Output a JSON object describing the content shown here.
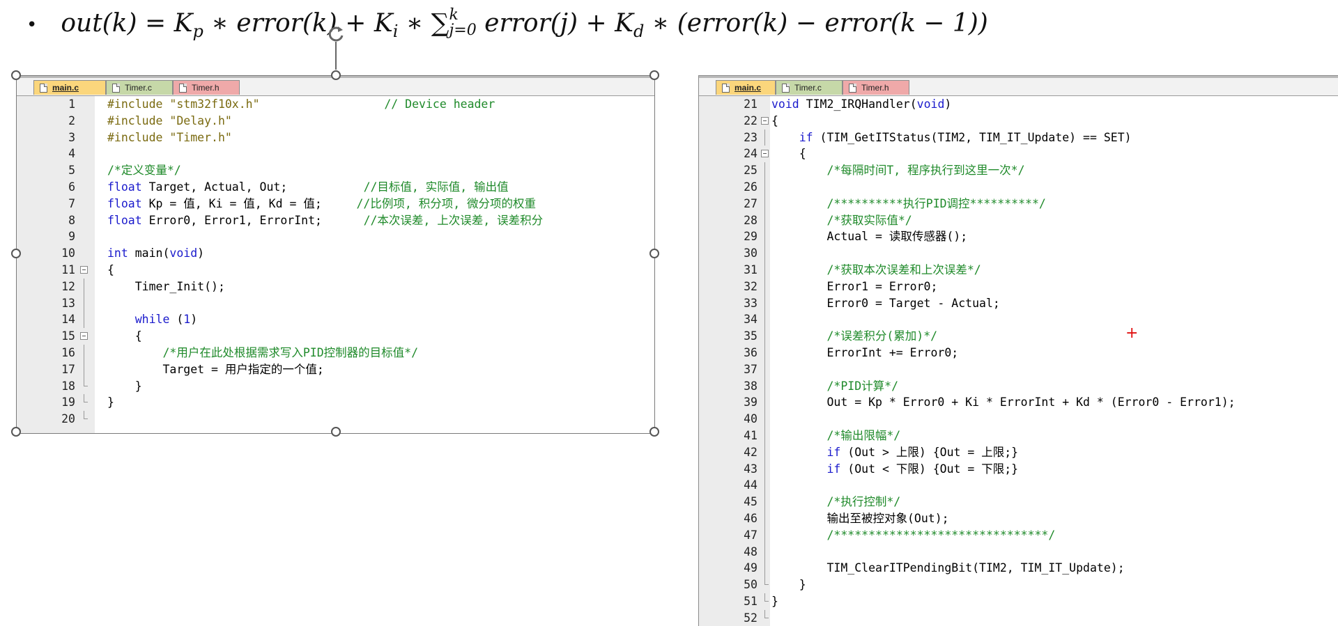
{
  "formula": {
    "bullet": "•",
    "lhs": "out(k) = K",
    "kp_sub": "p",
    "t1": " ∗ error(k) + K",
    "ki_sub": "i",
    "t2": " ∗ ",
    "sum": "∑",
    "sum_sup": "k",
    "sum_sub": "j=0",
    "t3": " error(j) + K",
    "kd_sub": "d",
    "t4": " ∗ (error(k) − error(k − 1))"
  },
  "tabs": [
    "main.c",
    "Timer.c",
    "Timer.h"
  ],
  "left_code": [
    {
      "n": "1",
      "fold": "",
      "segs": [
        [
          "pp",
          "#include "
        ],
        [
          "str",
          "\"stm32f10x.h\""
        ],
        [
          "",
          "                  "
        ],
        [
          "cm",
          "// Device header"
        ]
      ]
    },
    {
      "n": "2",
      "fold": "",
      "segs": [
        [
          "pp",
          "#include "
        ],
        [
          "str",
          "\"Delay.h\""
        ]
      ]
    },
    {
      "n": "3",
      "fold": "",
      "segs": [
        [
          "pp",
          "#include "
        ],
        [
          "str",
          "\"Timer.h\""
        ]
      ]
    },
    {
      "n": "4",
      "fold": "",
      "segs": []
    },
    {
      "n": "5",
      "fold": "",
      "segs": [
        [
          "cm",
          "/*定义变量*/"
        ]
      ]
    },
    {
      "n": "6",
      "fold": "",
      "segs": [
        [
          "kw",
          "float"
        ],
        [
          "",
          " Target, Actual, Out;           "
        ],
        [
          "cm",
          "//目标值, 实际值, 输出值"
        ]
      ]
    },
    {
      "n": "7",
      "fold": "",
      "segs": [
        [
          "kw",
          "float"
        ],
        [
          "",
          " Kp = 值, Ki = 值, Kd = 值;     "
        ],
        [
          "cm",
          "//比例项, 积分项, 微分项的权重"
        ]
      ]
    },
    {
      "n": "8",
      "fold": "",
      "segs": [
        [
          "kw",
          "float"
        ],
        [
          "",
          " Error0, Error1, ErrorInt;      "
        ],
        [
          "cm",
          "//本次误差, 上次误差, 误差积分"
        ]
      ]
    },
    {
      "n": "9",
      "fold": "",
      "segs": []
    },
    {
      "n": "10",
      "fold": "",
      "segs": [
        [
          "kw",
          "int"
        ],
        [
          "",
          " main("
        ],
        [
          "kw",
          "void"
        ],
        [
          "",
          ")"
        ]
      ]
    },
    {
      "n": "11",
      "fold": "box",
      "segs": [
        [
          "",
          "{"
        ]
      ]
    },
    {
      "n": "12",
      "fold": "mid",
      "segs": [
        [
          "",
          "    Timer_Init();"
        ]
      ]
    },
    {
      "n": "13",
      "fold": "mid",
      "segs": []
    },
    {
      "n": "14",
      "fold": "mid",
      "segs": [
        [
          "",
          "    "
        ],
        [
          "kw",
          "while"
        ],
        [
          "",
          " ("
        ],
        [
          "num",
          "1"
        ],
        [
          "",
          ")"
        ]
      ]
    },
    {
      "n": "15",
      "fold": "box",
      "segs": [
        [
          "",
          "    {"
        ]
      ]
    },
    {
      "n": "16",
      "fold": "mid",
      "segs": [
        [
          "",
          "        "
        ],
        [
          "cm",
          "/*用户在此处根据需求写入PID控制器的目标值*/"
        ]
      ]
    },
    {
      "n": "17",
      "fold": "mid",
      "segs": [
        [
          "",
          "        Target = 用户指定的一个值;"
        ]
      ]
    },
    {
      "n": "18",
      "fold": "end",
      "segs": [
        [
          "",
          "    }"
        ]
      ]
    },
    {
      "n": "19",
      "fold": "end",
      "segs": [
        [
          "",
          "}"
        ]
      ]
    },
    {
      "n": "20",
      "fold": "end",
      "segs": []
    }
  ],
  "right_code": [
    {
      "n": "21",
      "fold": "",
      "segs": [
        [
          "kw",
          "void"
        ],
        [
          "",
          " TIM2_IRQHandler("
        ],
        [
          "kw",
          "void"
        ],
        [
          "",
          ")"
        ]
      ]
    },
    {
      "n": "22",
      "fold": "box",
      "segs": [
        [
          "",
          "{"
        ]
      ]
    },
    {
      "n": "23",
      "fold": "mid",
      "segs": [
        [
          "",
          "    "
        ],
        [
          "kw",
          "if"
        ],
        [
          "",
          " (TIM_GetITStatus(TIM2, TIM_IT_Update) == SET)"
        ]
      ]
    },
    {
      "n": "24",
      "fold": "box",
      "segs": [
        [
          "",
          "    {"
        ]
      ]
    },
    {
      "n": "25",
      "fold": "mid",
      "segs": [
        [
          "",
          "        "
        ],
        [
          "cm",
          "/*每隔时间T, 程序执行到这里一次*/"
        ]
      ]
    },
    {
      "n": "26",
      "fold": "mid",
      "segs": []
    },
    {
      "n": "27",
      "fold": "mid",
      "segs": [
        [
          "",
          "        "
        ],
        [
          "cm",
          "/**********执行PID调控**********/"
        ]
      ]
    },
    {
      "n": "28",
      "fold": "mid",
      "segs": [
        [
          "",
          "        "
        ],
        [
          "cm",
          "/*获取实际值*/"
        ]
      ]
    },
    {
      "n": "29",
      "fold": "mid",
      "segs": [
        [
          "",
          "        Actual = 读取传感器();"
        ]
      ]
    },
    {
      "n": "30",
      "fold": "mid",
      "segs": []
    },
    {
      "n": "31",
      "fold": "mid",
      "segs": [
        [
          "",
          "        "
        ],
        [
          "cm",
          "/*获取本次误差和上次误差*/"
        ]
      ]
    },
    {
      "n": "32",
      "fold": "mid",
      "segs": [
        [
          "",
          "        Error1 = Error0;"
        ]
      ]
    },
    {
      "n": "33",
      "fold": "mid",
      "segs": [
        [
          "",
          "        Error0 = Target - Actual;"
        ]
      ]
    },
    {
      "n": "34",
      "fold": "mid",
      "segs": []
    },
    {
      "n": "35",
      "fold": "mid",
      "segs": [
        [
          "",
          "        "
        ],
        [
          "cm",
          "/*误差积分(累加)*/"
        ]
      ]
    },
    {
      "n": "36",
      "fold": "mid",
      "segs": [
        [
          "",
          "        ErrorInt += Error0;"
        ]
      ]
    },
    {
      "n": "37",
      "fold": "mid",
      "segs": []
    },
    {
      "n": "38",
      "fold": "mid",
      "segs": [
        [
          "",
          "        "
        ],
        [
          "cm",
          "/*PID计算*/"
        ]
      ]
    },
    {
      "n": "39",
      "fold": "mid",
      "segs": [
        [
          "",
          "        Out = Kp * Error0 + Ki * ErrorInt + Kd * (Error0 - Error1);"
        ]
      ]
    },
    {
      "n": "40",
      "fold": "mid",
      "segs": []
    },
    {
      "n": "41",
      "fold": "mid",
      "segs": [
        [
          "",
          "        "
        ],
        [
          "cm",
          "/*输出限幅*/"
        ]
      ]
    },
    {
      "n": "42",
      "fold": "mid",
      "segs": [
        [
          "",
          "        "
        ],
        [
          "kw",
          "if"
        ],
        [
          "",
          " (Out > 上限) {Out = 上限;}"
        ]
      ]
    },
    {
      "n": "43",
      "fold": "mid",
      "segs": [
        [
          "",
          "        "
        ],
        [
          "kw",
          "if"
        ],
        [
          "",
          " (Out < 下限) {Out = 下限;}"
        ]
      ]
    },
    {
      "n": "44",
      "fold": "mid",
      "segs": []
    },
    {
      "n": "45",
      "fold": "mid",
      "segs": [
        [
          "",
          "        "
        ],
        [
          "cm",
          "/*执行控制*/"
        ]
      ]
    },
    {
      "n": "46",
      "fold": "mid",
      "segs": [
        [
          "",
          "        输出至被控对象(Out);"
        ]
      ]
    },
    {
      "n": "47",
      "fold": "mid",
      "segs": [
        [
          "",
          "        "
        ],
        [
          "cm",
          "/*******************************/"
        ]
      ]
    },
    {
      "n": "48",
      "fold": "mid",
      "segs": []
    },
    {
      "n": "49",
      "fold": "mid",
      "segs": [
        [
          "",
          "        TIM_ClearITPendingBit(TIM2, TIM_IT_Update);"
        ]
      ]
    },
    {
      "n": "50",
      "fold": "end",
      "segs": [
        [
          "",
          "    }"
        ]
      ]
    },
    {
      "n": "51",
      "fold": "end",
      "segs": [
        [
          "",
          "}"
        ]
      ]
    },
    {
      "n": "52",
      "fold": "end",
      "segs": []
    }
  ],
  "cursor_mark": "+",
  "colors": {
    "tab_active": "#fbd67c",
    "tab_c": "#c6d8a8",
    "tab_h": "#efa9a9",
    "keyword": "#1a1acc",
    "comment": "#1f8a2a",
    "preproc": "#7a6a10",
    "cursor": "#e01010"
  },
  "icons": [
    "file-icon",
    "rotate-icon",
    "resize-handle-icon",
    "fold-box-icon"
  ]
}
